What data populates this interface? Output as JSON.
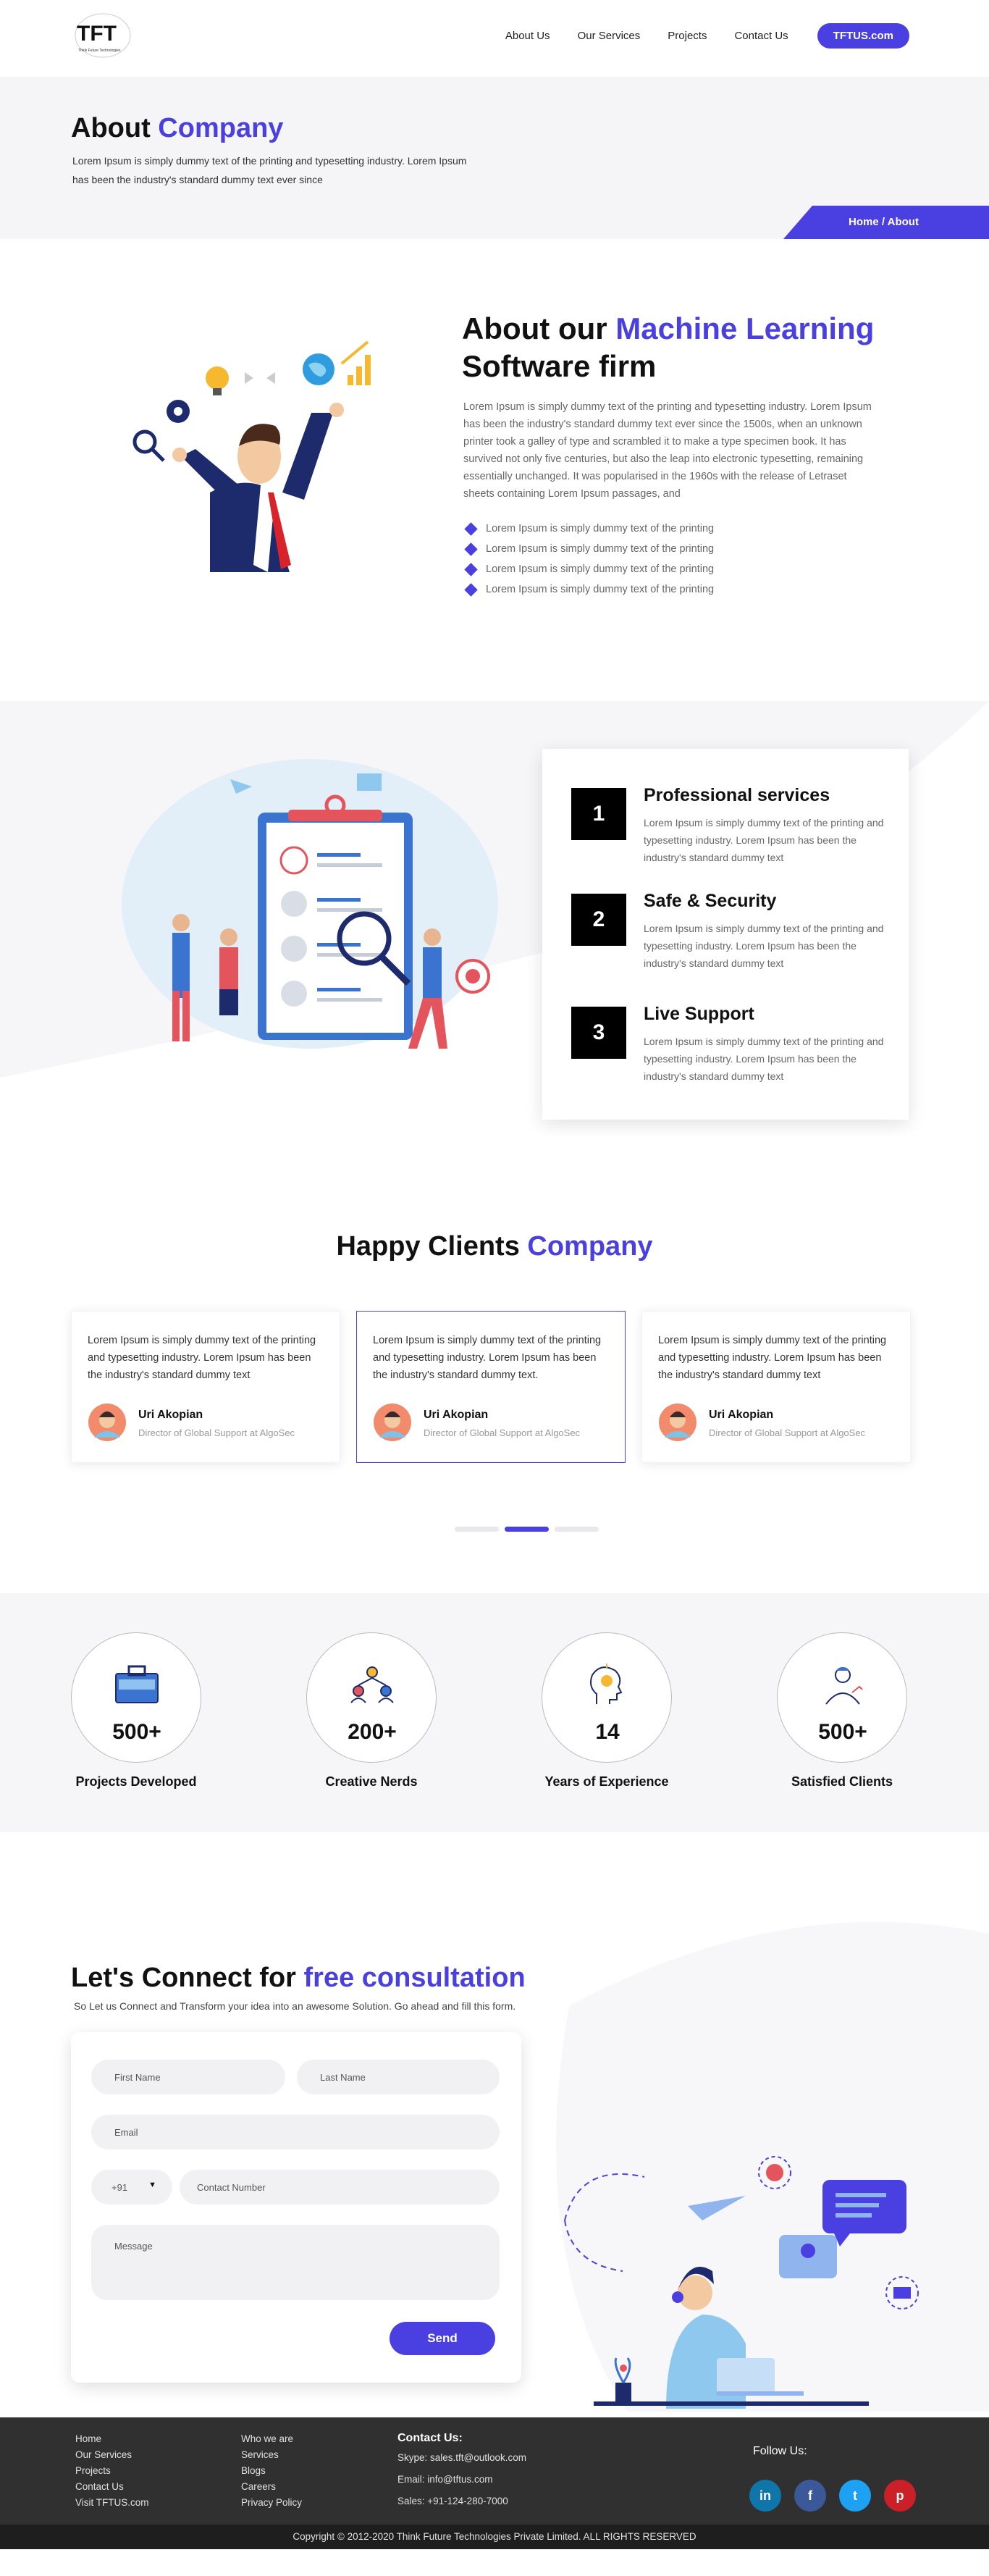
{
  "header": {
    "logo_text": "TFT",
    "logo_subtext": "Think Future Technologies",
    "nav": [
      "About Us",
      "Our Services",
      "Projects",
      "Contact Us"
    ],
    "cta": "TFTUS.com"
  },
  "banner": {
    "title_plain": "About ",
    "title_accent": "Company",
    "text": "Lorem Ipsum is simply dummy text of the printing and typesetting industry. Lorem Ipsum has been the industry's standard dummy text ever since",
    "breadcrumb": "Home / About"
  },
  "ml": {
    "title_plain": "About our ",
    "title_accent": "Machine Learning",
    "title_line2": "Software firm",
    "desc": "Lorem Ipsum is simply dummy text of the printing and typesetting industry. Lorem Ipsum has been the industry's standard dummy text ever since the 1500s, when an unknown printer took a galley of type and scrambled it to make a type specimen book. It has survived not only five centuries, but also the leap into electronic typesetting, remaining essentially unchanged. It was popularised in the 1960s with the release of Letraset sheets containing Lorem Ipsum passages, and",
    "bullets": [
      "Lorem Ipsum is simply dummy text of the printing",
      "Lorem Ipsum is simply dummy text of the printing",
      "Lorem Ipsum is simply dummy text of the printing",
      "Lorem Ipsum is simply dummy text of the printing"
    ]
  },
  "services": [
    {
      "num": "1",
      "title": "Professional services",
      "text": "Lorem Ipsum is simply dummy text of the printing and typesetting industry. Lorem Ipsum has been the industry's standard dummy text"
    },
    {
      "num": "2",
      "title": "Safe & Security",
      "text": "Lorem Ipsum is simply dummy text of the printing and typesetting industry. Lorem Ipsum has been the industry's standard dummy text"
    },
    {
      "num": "3",
      "title": "Live Support",
      "text": "Lorem Ipsum is simply dummy text of the printing and typesetting industry. Lorem Ipsum has been the industry's standard dummy text"
    }
  ],
  "clients": {
    "title_plain": "Happy Clients ",
    "title_accent": "Company",
    "items": [
      {
        "text": "Lorem Ipsum is simply dummy text of the printing and typesetting industry. Lorem Ipsum has been the industry's standard dummy text",
        "name": "Uri Akopian",
        "role": "Director of Global Support at AlgoSec"
      },
      {
        "text": "Lorem Ipsum is simply dummy text of the printing and typesetting industry. Lorem Ipsum has been the industry's standard dummy text.",
        "name": "Uri Akopian",
        "role": "Director of Global Support at AlgoSec"
      },
      {
        "text": "Lorem Ipsum is simply dummy text of the printing and typesetting industry. Lorem Ipsum has been the industry's standard dummy text",
        "name": "Uri Akopian",
        "role": "Director of Global Support at AlgoSec"
      }
    ],
    "active_slide": 2
  },
  "stats": [
    {
      "value": "500+",
      "label": "Projects Developed",
      "icon": "briefcase-icon"
    },
    {
      "value": "200+",
      "label": "Creative Nerds",
      "icon": "team-icon"
    },
    {
      "value": "14",
      "label": "Years of Experience",
      "icon": "idea-head-icon"
    },
    {
      "value": "500+",
      "label": "Satisfied Clients",
      "icon": "happy-client-icon"
    }
  ],
  "contact": {
    "title_plain": "Let's Connect for ",
    "title_accent": "free consultation",
    "sub": "So Let us Connect and Transform your idea into an awesome Solution. Go ahead and fill this form.",
    "first_name": "First Name",
    "last_name": "Last Name",
    "email": "Email",
    "country_code": "+91",
    "contact_number": "Contact Number",
    "message": "Message",
    "send": "Send"
  },
  "footer": {
    "col1": [
      "Home",
      "Our Services",
      "Projects",
      "Contact Us",
      "Visit TFTUS.com"
    ],
    "col2": [
      "Who we are",
      "Services",
      "Blogs",
      "Careers",
      "Privacy Policy"
    ],
    "contact_title": "Contact Us:",
    "skype": "Skype: sales.tft@outlook.com",
    "email": "Email: info@tftus.com",
    "sales": "Sales: +91-124-280-7000",
    "follow": "Follow Us:",
    "social": [
      "in",
      "f",
      "t",
      "p"
    ],
    "copyright": "Copyright © 2012-2020 Think Future Technologies Private Limited. ALL RIGHTS RESERVED"
  },
  "colors": {
    "accent": "#4a3fe0",
    "footer": "#303030",
    "linkedin": "#0e76a8",
    "facebook": "#3b5998",
    "twitter": "#1da1f2",
    "pinterest": "#cb2027"
  }
}
